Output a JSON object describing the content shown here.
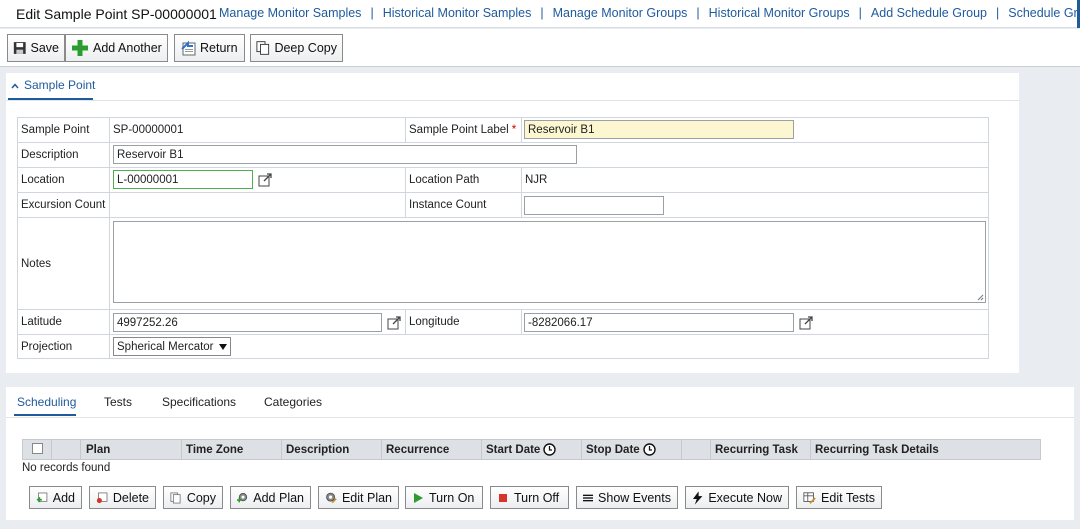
{
  "header": {
    "title": "Edit Sample Point SP-00000001",
    "links": [
      "Manage Monitor Samples",
      "Historical Monitor Samples",
      "Manage Monitor Groups",
      "Historical Monitor Groups",
      "Add Schedule Group",
      "Schedule Groups"
    ],
    "separator": "|"
  },
  "toolbar": {
    "save": "Save",
    "add_another": "Add Another",
    "return": "Return",
    "deep_copy": "Deep Copy"
  },
  "section": {
    "tab_label": "Sample Point"
  },
  "form": {
    "sample_point_label": "Sample Point",
    "sample_point_value": "SP-00000001",
    "sample_point_label_label": "Sample Point Label",
    "required_mark": "*",
    "sample_point_label_value": "Reservoir B1",
    "description_label": "Description",
    "description_value": "Reservoir B1",
    "location_label": "Location",
    "location_value": "L-00000001",
    "location_path_label": "Location Path",
    "location_path_value": "NJR",
    "excursion_count_label": "Excursion Count",
    "instance_count_label": "Instance Count",
    "instance_count_value": "",
    "notes_label": "Notes",
    "notes_value": "",
    "latitude_label": "Latitude",
    "latitude_value": "4997252.26",
    "longitude_label": "Longitude",
    "longitude_value": "-8282066.17",
    "projection_label": "Projection",
    "projection_value": "Spherical Mercator"
  },
  "bottom_tabs": [
    "Scheduling",
    "Tests",
    "Specifications",
    "Categories"
  ],
  "grid": {
    "columns": [
      "Plan",
      "Time Zone",
      "Description",
      "Recurrence",
      "Start Date",
      "Stop Date",
      "Recurring Task",
      "Recurring Task Details"
    ],
    "empty_text": "No records found"
  },
  "grid_buttons": {
    "add": "Add",
    "delete": "Delete",
    "copy": "Copy",
    "add_plan": "Add Plan",
    "edit_plan": "Edit Plan",
    "turn_on": "Turn On",
    "turn_off": "Turn Off",
    "show_events": "Show Events",
    "execute_now": "Execute Now",
    "edit_tests": "Edit Tests"
  },
  "colors": {
    "link": "#1f5a9c",
    "required_field_bg": "#fcf7d0",
    "location_border": "#4caf50"
  }
}
